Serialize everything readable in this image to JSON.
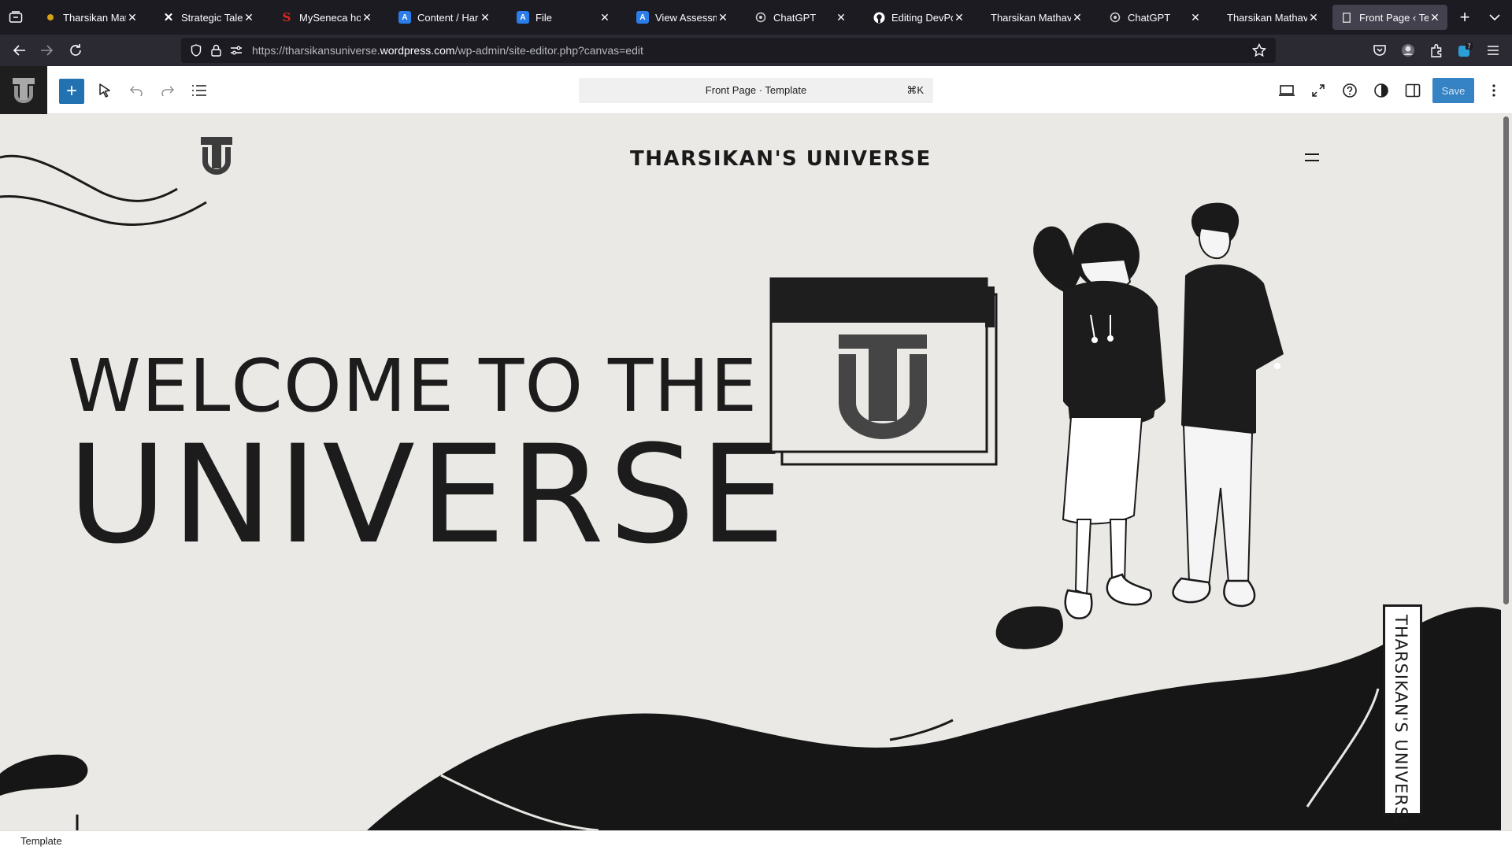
{
  "browser": {
    "tabs": [
      {
        "title": "Tharsikan Mathav",
        "favicon": "yellow-dot",
        "color": "#d4a017",
        "active": false
      },
      {
        "title": "Strategic Talent A",
        "favicon": "x-logo",
        "color": "#ffffff",
        "active": false
      },
      {
        "title": "MySeneca homep",
        "favicon": "seneca-s",
        "color": "#da291c",
        "active": false
      },
      {
        "title": "Content / Hardwa",
        "favicon": "a-logo",
        "color": "#2b7de9",
        "active": false
      },
      {
        "title": "File",
        "favicon": "a-logo",
        "color": "#2b7de9",
        "active": false
      },
      {
        "title": "View Assessment",
        "favicon": "a-logo",
        "color": "#2b7de9",
        "active": false
      },
      {
        "title": "ChatGPT",
        "favicon": "chatgpt-logo",
        "color": "#d0d0d0",
        "active": false
      },
      {
        "title": "Editing DevPortfo",
        "favicon": "github-logo",
        "color": "#ffffff",
        "active": false
      },
      {
        "title": "Tharsikan Mathavan",
        "favicon": "none",
        "color": "",
        "active": false
      },
      {
        "title": "ChatGPT",
        "favicon": "chatgpt-logo",
        "color": "#d0d0d0",
        "active": false
      },
      {
        "title": "Tharsikan Mathavan",
        "favicon": "none",
        "color": "",
        "active": false
      },
      {
        "title": "Front Page ‹ Tem",
        "favicon": "page-icon",
        "color": "#d0d0d0",
        "active": true
      }
    ],
    "url_prefix": "https://tharsikansuniverse.",
    "url_domain": "wordpress.com",
    "url_path": "/wp-admin/site-editor.php?canvas=edit",
    "extensions_badge": "7"
  },
  "editor": {
    "document_title": "Front Page · Template",
    "shortcut": "⌘K",
    "save_label": "Save",
    "accent": "#2271b1"
  },
  "page": {
    "site_title": "THARSIKAN'S UNIVERSE",
    "hero_line1": "WELCOME TO THE",
    "hero_line2": "UNIVERSE",
    "vertical_badge": "THARSIKAN'S UNIVERSE",
    "logo_letter": "T"
  },
  "status": {
    "breadcrumb": "Template"
  }
}
